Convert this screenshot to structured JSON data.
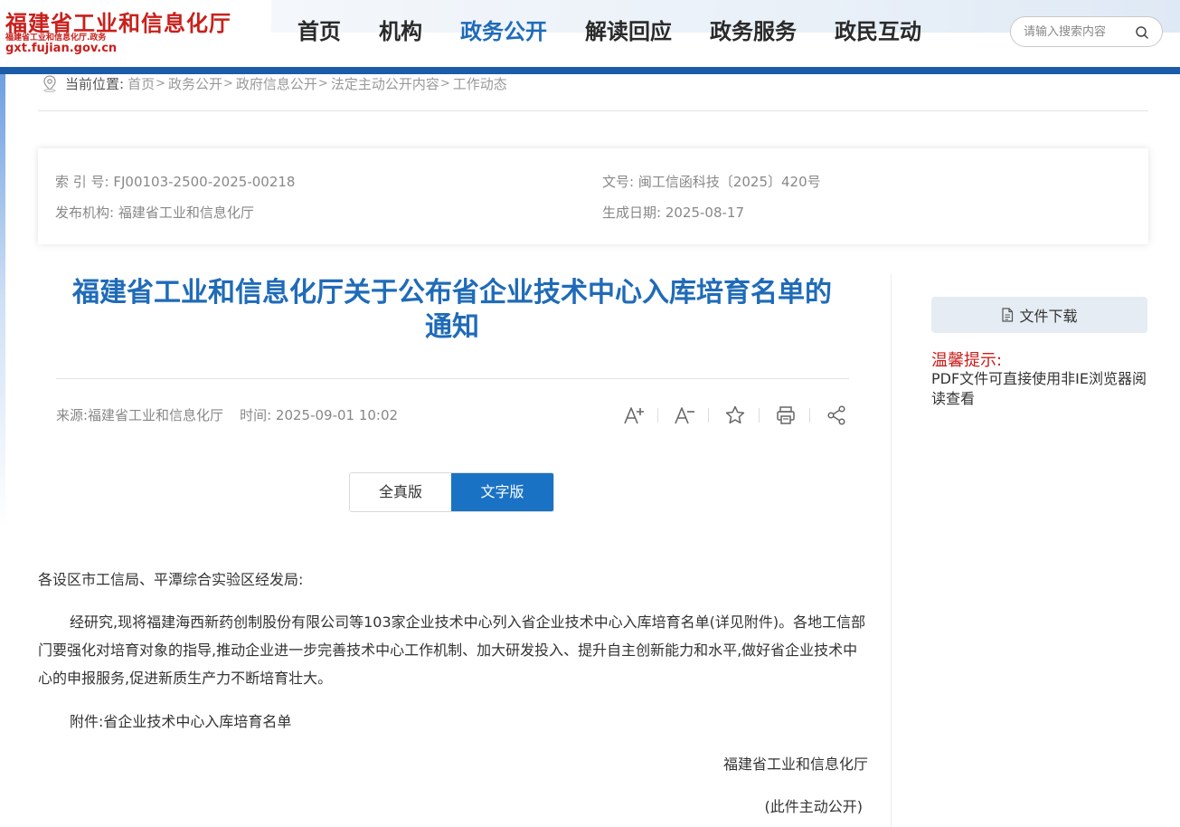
{
  "header": {
    "logo": {
      "title": "福建省工业和信息化厅",
      "subtitle": "福建省工业和信息化厅.政务",
      "url": "gxt.fujian.gov.cn"
    },
    "nav": [
      {
        "label": "首页",
        "active": false
      },
      {
        "label": "机构",
        "active": false
      },
      {
        "label": "政务公开",
        "active": true
      },
      {
        "label": "解读回应",
        "active": false
      },
      {
        "label": "政务服务",
        "active": false
      },
      {
        "label": "政民互动",
        "active": false
      }
    ],
    "search": {
      "placeholder": "请输入搜索内容",
      "icon": "search-icon"
    },
    "accent_color": "#1f6bb8",
    "bar_color": "#1c5ba8"
  },
  "breadcrumb": {
    "label": "当前位置:",
    "items": [
      "首页",
      "政务公开",
      "政府信息公开",
      "法定主动公开内容",
      "工作动态"
    ],
    "separator": ">"
  },
  "info": {
    "index_label": "索 引 号:",
    "index_value": "FJ00103-2500-2025-00218",
    "doc_no_label": "文号:",
    "doc_no_value": "闽工信函科技〔2025〕420号",
    "publisher_label": "发布机构:",
    "publisher_value": "福建省工业和信息化厅",
    "date_label": "生成日期:",
    "date_value": "2025-08-17"
  },
  "article": {
    "title_line1": "福建省工业和信息化厅关于公布省企业技术中心入库培育名单的",
    "title_line2": "通知",
    "source": "来源:福建省工业和信息化厅",
    "time_label": "时间:",
    "time_value": "2025-09-01 10:02",
    "tools": [
      "font-increase-icon",
      "font-decrease-icon",
      "star-icon",
      "print-icon",
      "share-icon"
    ],
    "version_toggle": {
      "full": "全真版",
      "text": "文字版",
      "active": "text"
    },
    "salutation": "各设区市工信局、平潭综合实验区经发局:",
    "paragraph": "经研究,现将福建海西新药创制股份有限公司等103家企业技术中心列入省企业技术中心入库培育名单(详见附件)。各地工信部门要强化对培育对象的指导,推动企业进一步完善技术中心工作机制、加大研发投入、提升自主创新能力和水平,做好省企业技术中心的申报服务,促进新质生产力不断培育壮大。",
    "attachment": "附件:省企业技术中心入库培育名单",
    "signature": "福建省工业和信息化厅",
    "disclosure": "(此件主动公开)"
  },
  "sidebar": {
    "download_label": "文件下载",
    "tip_title": "温馨提示:",
    "tip_text": "PDF文件可直接使用非IE浏览器阅读查看"
  }
}
